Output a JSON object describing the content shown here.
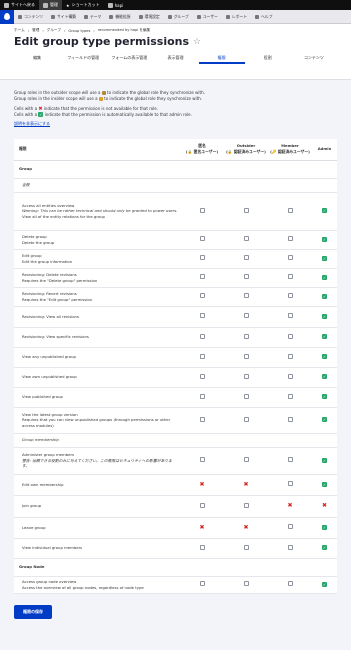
{
  "toolbar": {
    "back": "サイトへ戻る",
    "manage": "管理",
    "shortcuts": "ショートカット",
    "user": "hapi"
  },
  "admin_menu": [
    {
      "label": "コンテンツ",
      "icon": "content-icon"
    },
    {
      "label": "サイト構築",
      "icon": "structure-icon"
    },
    {
      "label": "テーマ",
      "icon": "appearance-icon"
    },
    {
      "label": "機能拡張",
      "icon": "extend-icon"
    },
    {
      "label": "環境設定",
      "icon": "config-icon"
    },
    {
      "label": "グループ",
      "icon": "group-icon"
    },
    {
      "label": "ユーザー",
      "icon": "people-icon"
    },
    {
      "label": "レポート",
      "icon": "reports-icon"
    },
    {
      "label": "ヘルプ",
      "icon": "help-icon"
    }
  ],
  "breadcrumb": [
    "ホーム",
    "管理",
    "グループ",
    "Group types",
    "recommended by hapi を編集"
  ],
  "breadcrumb_sep": "›",
  "page_title": "Edit group type permissions",
  "tabs": [
    {
      "label": "編集",
      "active": false
    },
    {
      "label": "フィールドの管理",
      "active": false
    },
    {
      "label": "フォームの表示管理",
      "active": false
    },
    {
      "label": "表示管理",
      "active": false
    },
    {
      "label": "権限",
      "active": true
    },
    {
      "label": "役割",
      "active": false
    },
    {
      "label": "コンテンツ",
      "active": false
    }
  ],
  "help": {
    "line1a": "Group roles in the outsider scope will use a",
    "line1b": "to indicate the global role they synchronize with.",
    "line2a": "Group roles in the insider scope will use a",
    "line2b": "to indicate the global role they synchronize with.",
    "line3a": "Cells with a",
    "line3b": "indicate that the permission is not available for that role.",
    "line4a": "Cells with a",
    "line4b": "indicate that the permission is automatically available to that admin role.",
    "hide_desc": "説明を非表示にする"
  },
  "columns": {
    "permission": "権限",
    "anon": "匿名\n(🔒 匿名ユーザー)",
    "outsider": "Outsider\n(🔒 認証済みユーザー)",
    "member": "Member\n(🔑 認証済みユーザー)",
    "admin": "Admin"
  },
  "rows": [
    {
      "type": "section",
      "title": "Group"
    },
    {
      "type": "sub",
      "title": "全般"
    },
    {
      "type": "perm",
      "title": "Access all entities overview",
      "desc": "Warning: This can be rather technical and should only be granted to power users.",
      "sub": "View all of the entity relations for the group",
      "cells": [
        "cb",
        "cb",
        "cb",
        "chk"
      ],
      "h": 38
    },
    {
      "type": "perm",
      "title": "Delete group",
      "sub": "Delete the group",
      "cells": [
        "cb",
        "cb",
        "cb",
        "chk"
      ],
      "h": 19
    },
    {
      "type": "perm",
      "title": "Edit group",
      "sub": "Edit the group information",
      "cells": [
        "cb",
        "cb",
        "cb",
        "chk"
      ],
      "h": 19
    },
    {
      "type": "perm",
      "title": "Revisioning: Delete revisions",
      "sub": "Requires the \"Delete group\" permission",
      "cells": [
        "cb",
        "cb",
        "cb",
        "chk"
      ],
      "h": 19
    },
    {
      "type": "perm",
      "title": "Revisioning: Revert revisions",
      "sub": "Requires the \"Edit group\" permission",
      "cells": [
        "cb",
        "cb",
        "cb",
        "chk"
      ],
      "h": 19
    },
    {
      "type": "perm",
      "title": "Revisioning: View all revisions",
      "cells": [
        "cb",
        "cb",
        "cb",
        "chk"
      ],
      "h": 21
    },
    {
      "type": "perm",
      "title": "Revisioning: View specific revisions",
      "cells": [
        "cb",
        "cb",
        "cb",
        "chk"
      ],
      "h": 20
    },
    {
      "type": "perm",
      "title": "View any unpublished group",
      "cells": [
        "cb",
        "cb",
        "cb",
        "chk"
      ],
      "h": 20
    },
    {
      "type": "perm",
      "title": "View own unpublished group",
      "cells": [
        "cb",
        "cb",
        "cb",
        "chk"
      ],
      "h": 20
    },
    {
      "type": "perm",
      "title": "View published group",
      "cells": [
        "cb",
        "cb",
        "cb",
        "chk"
      ],
      "h": 20
    },
    {
      "type": "perm",
      "title": "View the latest group version",
      "sub": "Requires that you can view unpublished groups (through permissions or other access modules)",
      "cells": [
        "cb",
        "cb",
        "cb",
        "chk"
      ],
      "h": 26
    },
    {
      "type": "sub",
      "title": "Group membership"
    },
    {
      "type": "perm",
      "title": "Administer group members",
      "desc": "警告: 信頼できる役割のみに与えてください。この権限はセキュリティへの影響があります。",
      "cells": [
        "cb",
        "cb",
        "cb",
        "chk"
      ],
      "h": 27
    },
    {
      "type": "perm",
      "title": "Edit own membership",
      "cells": [
        "x",
        "x",
        "cb",
        "chk"
      ],
      "h": 21
    },
    {
      "type": "perm",
      "title": "Join group",
      "cells": [
        "cb",
        "cb",
        "x",
        "x"
      ],
      "h": 22
    },
    {
      "type": "perm",
      "title": "Leave group",
      "cells": [
        "x",
        "x",
        "cb",
        "chk"
      ],
      "h": 21
    },
    {
      "type": "perm",
      "title": "View individual group members",
      "cells": [
        "cb",
        "cb",
        "cb",
        "chk"
      ],
      "h": 20
    },
    {
      "type": "section",
      "title": "Group Node"
    },
    {
      "type": "perm",
      "title": "Access group node overview",
      "sub": "Access the overview of all group nodes, regardless of node type",
      "cells": [
        "cb",
        "cb",
        "cb",
        "chk"
      ],
      "h": 17
    }
  ],
  "save_label": "権限の保存",
  "colors": {
    "accent": "#003cc5",
    "check": "#26a769",
    "cross": "#d72222"
  }
}
